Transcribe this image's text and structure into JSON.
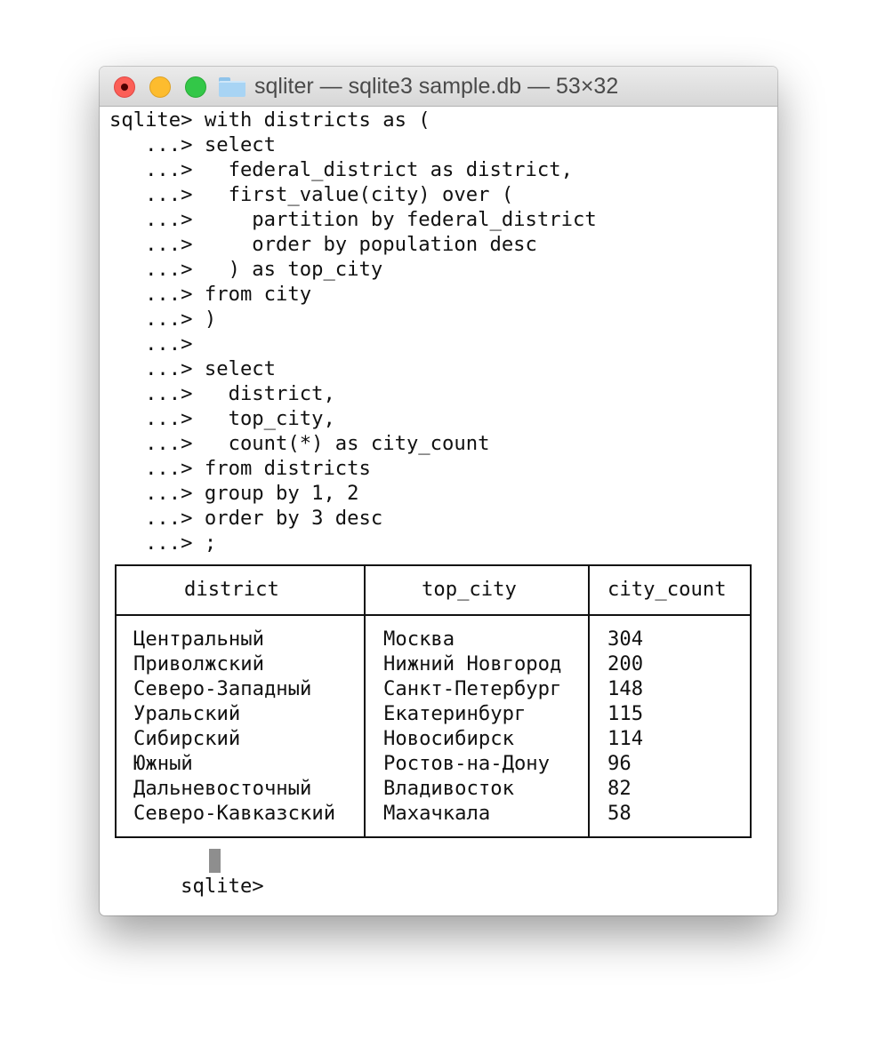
{
  "window": {
    "title": "sqliter — sqlite3 sample.db — 53×32",
    "folder_icon": "folder-icon",
    "controls": [
      "close-button",
      "minimize-button",
      "zoom-button"
    ],
    "colors": {
      "close": "#fc5f57",
      "minimize": "#fdbc2e",
      "zoom": "#33c748",
      "folder": "#a8d4f4"
    }
  },
  "terminal": {
    "lines": [
      "sqlite> with districts as (",
      "   ...> select",
      "   ...>   federal_district as district,",
      "   ...>   first_value(city) over (",
      "   ...>     partition by federal_district",
      "   ...>     order by population desc",
      "   ...>   ) as top_city",
      "   ...> from city",
      "   ...> )",
      "   ...>",
      "   ...> select",
      "   ...>   district,",
      "   ...>   top_city,",
      "   ...>   count(*) as city_count",
      "   ...> from districts",
      "   ...> group by 1, 2",
      "   ...> order by 3 desc",
      "   ...> ;"
    ],
    "table": {
      "columns": [
        "district",
        "top_city",
        "city_count"
      ],
      "rows": [
        [
          "Центральный",
          "Москва",
          "304"
        ],
        [
          "Приволжский",
          "Нижний Новгород",
          "200"
        ],
        [
          "Северо-Западный",
          "Санкт-Петербург",
          "148"
        ],
        [
          "Уральский",
          "Екатеринбург",
          "115"
        ],
        [
          "Сибирский",
          "Новосибирск",
          "114"
        ],
        [
          "Южный",
          "Ростов-на-Дону",
          "96"
        ],
        [
          "Дальневосточный",
          "Владивосток",
          "82"
        ],
        [
          "Северо-Кавказский",
          "Махачкала",
          "58"
        ]
      ]
    },
    "final_prompt": "sqlite> "
  }
}
